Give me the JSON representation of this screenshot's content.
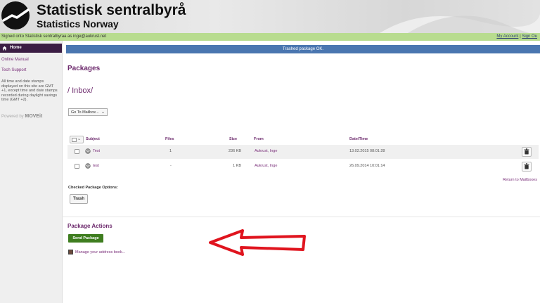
{
  "header": {
    "brand_line1": "Statistisk sentralbyrå",
    "brand_line2": "Statistics Norway"
  },
  "signbar": {
    "signed_text": "Signed onto Statistisk sentralbyraa as inge@aukrust.net",
    "my_account": "My Account",
    "separator": "|",
    "sign_out": "Sign Ou"
  },
  "sidebar": {
    "home": "Home",
    "online_manual": "Online Manual",
    "tech_support": "Tech Support",
    "note": "All time and date stamps displayed on this site are GMT +1, except time and date stamps recorded during daylight savings time (GMT +2).",
    "powered_by": "Powered by",
    "powered_brand": "MOVEit"
  },
  "notice": "Trashed package OK.",
  "main": {
    "title": "Packages",
    "folder": "/  Inbox/",
    "mailbox_select": "Go To Mailbox...",
    "columns": {
      "subject": "Subject",
      "files": "Files",
      "size": "Size",
      "from": "From",
      "datetime": "Date/Time"
    },
    "rows": [
      {
        "subject": "Test",
        "files": "1",
        "size": "236 KB",
        "from": "Aukrust, Inge",
        "datetime": "13.02.2015 08:01:28"
      },
      {
        "subject": "test",
        "files": "-",
        "size": "1 KB",
        "from": "Aukrust, Inge",
        "datetime": "26.09.2014 10:01:14"
      }
    ],
    "return_link": "Return to Mailboxes",
    "checked_options": "Checked Package Options:",
    "trash_button": "Trash"
  },
  "actions": {
    "title": "Package Actions",
    "send_button": "Send Package",
    "address_book_link": "Manage your address book..."
  },
  "colors": {
    "accent_purple": "#6d2a6d",
    "notice_blue": "#4a76b0",
    "sign_green": "#b8dc8f",
    "send_green": "#3e7d1f",
    "arrow_red": "#e0141e"
  }
}
